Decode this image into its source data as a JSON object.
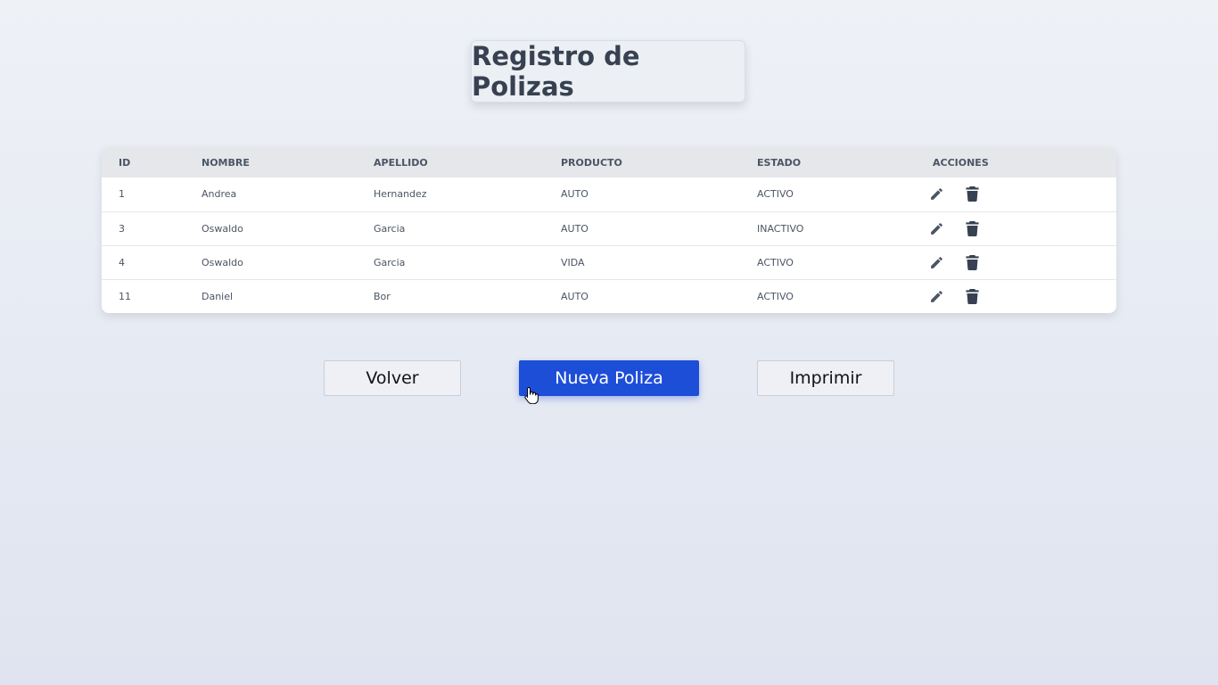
{
  "page": {
    "title": "Registro de Polizas"
  },
  "table": {
    "headers": {
      "id": "ID",
      "nombre": "NOMBRE",
      "apellido": "APELLIDO",
      "producto": "PRODUCTO",
      "estado": "ESTADO",
      "acciones": "ACCIONES"
    },
    "rows": [
      {
        "id": "1",
        "nombre": "Andrea",
        "apellido": "Hernandez",
        "producto": "AUTO",
        "estado": "ACTIVO"
      },
      {
        "id": "3",
        "nombre": "Oswaldo",
        "apellido": "Garcia",
        "producto": "AUTO",
        "estado": "INACTIVO"
      },
      {
        "id": "4",
        "nombre": "Oswaldo",
        "apellido": "Garcia",
        "producto": "VIDA",
        "estado": "ACTIVO"
      },
      {
        "id": "11",
        "nombre": "Daniel",
        "apellido": "Bor",
        "producto": "AUTO",
        "estado": "ACTIVO"
      }
    ],
    "row_actions": [
      "pencil-icon",
      "trash-icon"
    ]
  },
  "buttons": {
    "back_label": "Volver",
    "new_label": "Nueva Poliza",
    "print_label": "Imprimir"
  },
  "colors": {
    "primary": "#1d4ed8",
    "text": "#374151",
    "header_bg": "#e5e7eb"
  }
}
